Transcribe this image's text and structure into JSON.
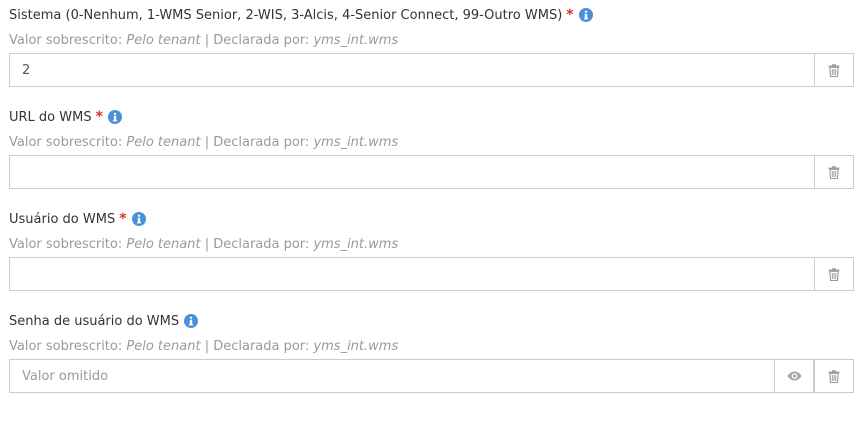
{
  "fields": [
    {
      "label": "Sistema (0-Nenhum, 1-WMS Senior, 2-WIS, 3-Alcis, 4-Senior Connect, 99-Outro WMS)",
      "required": "*",
      "meta_prefix": "Valor sobrescrito: ",
      "meta_scope": "Pelo tenant",
      "meta_sep": " | Declarada por: ",
      "meta_decl": "yms_int.wms",
      "value": "2"
    },
    {
      "label": "URL do WMS",
      "required": "*",
      "meta_prefix": "Valor sobrescrito: ",
      "meta_scope": "Pelo tenant",
      "meta_sep": " | Declarada por: ",
      "meta_decl": "yms_int.wms",
      "value": ""
    },
    {
      "label": "Usuário do WMS",
      "required": "*",
      "meta_prefix": "Valor sobrescrito: ",
      "meta_scope": "Pelo tenant",
      "meta_sep": " | Declarada por: ",
      "meta_decl": "yms_int.wms",
      "value": ""
    },
    {
      "label": "Senha de usuário do WMS",
      "meta_prefix": "Valor sobrescrito: ",
      "meta_scope": "Pelo tenant",
      "meta_sep": " | Declarada por: ",
      "meta_decl": "yms_int.wms",
      "placeholder": "Valor omitido"
    }
  ],
  "icons": {
    "info": "info-circle-icon",
    "delete": "trash-icon",
    "reveal": "eye-icon"
  },
  "colors": {
    "required": "#d9302c",
    "info": "#4a90d9",
    "muted": "#9a9a9a",
    "border": "#cccccc"
  }
}
